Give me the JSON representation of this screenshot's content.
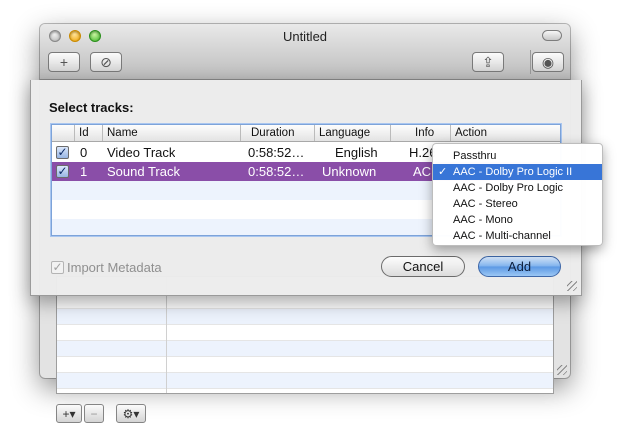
{
  "window": {
    "title": "Untitled",
    "toolbar": {
      "add_icon": "plus-icon",
      "disable_icon": "prohibited-icon",
      "share_icon": "share-icon",
      "inspector_icon": "inspector-icon",
      "add_glyph": "+",
      "disable_glyph": "⊘",
      "share_glyph": "⇪",
      "inspector_glyph": "◉"
    },
    "bottom_bar": {
      "add_label": "+▾",
      "remove_label": "−",
      "action_label": "⚙▾"
    }
  },
  "sheet": {
    "title": "Select tracks:",
    "columns": [
      "",
      "Id",
      "Name",
      "Duration",
      "Language",
      "Info",
      "Action"
    ],
    "rows": [
      {
        "checked": true,
        "check_glyph": "✓",
        "id": "0",
        "name": "Video Track",
        "duration": "0:58:52…",
        "language": "English",
        "info": "H.264",
        "selected": false
      },
      {
        "checked": true,
        "check_glyph": "✓",
        "id": "1",
        "name": "Sound Track",
        "duration": "0:58:52…",
        "language": "Unknown",
        "info": "AC",
        "selected": true
      }
    ],
    "import_metadata_label": "Import Metadata",
    "import_metadata_checked": true,
    "import_metadata_glyph": "✓",
    "cancel_label": "Cancel",
    "add_label": "Add"
  },
  "action_menu": {
    "items": [
      {
        "label": "Passthru",
        "checked": false
      },
      {
        "label": "AAC - Dolby Pro Logic II",
        "checked": true
      },
      {
        "label": "AAC - Dolby Pro Logic",
        "checked": false
      },
      {
        "label": "AAC - Stereo",
        "checked": false
      },
      {
        "label": "AAC - Mono",
        "checked": false
      },
      {
        "label": "AAC - Multi-channel",
        "checked": false
      }
    ],
    "check_glyph": "✓"
  },
  "colors": {
    "selection_row": "#8a4ea8",
    "menu_highlight": "#3875d7",
    "default_button": "#5a98e4"
  }
}
